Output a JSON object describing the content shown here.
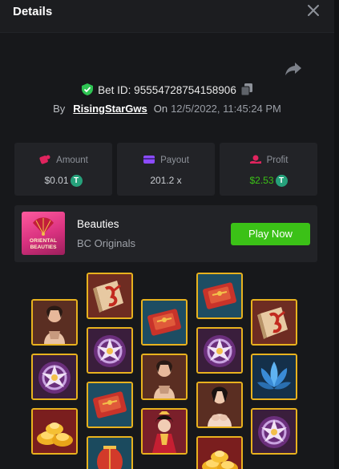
{
  "header": {
    "title": "Details",
    "close_icon": "close-icon"
  },
  "bet": {
    "bet_id_label": "Bet ID: 95554728754158906",
    "by_label": "By",
    "username": "RisingStarGws",
    "on_label": "On",
    "datetime": "12/5/2022, 11:45:24 PM"
  },
  "stats": {
    "amount": {
      "label": "Amount",
      "value": "$0.01",
      "icon": "dice-icon"
    },
    "payout": {
      "label": "Payout",
      "value": "201.2 x",
      "icon": "wallet-icon"
    },
    "profit": {
      "label": "Profit",
      "value": "$2.53",
      "icon": "money-hand-icon"
    }
  },
  "game": {
    "thumbnail_text_1": "ORIENTAL",
    "thumbnail_text_2": "BEAUTIES",
    "name": "Beauties",
    "provider": "BC Originals",
    "play_button": "Play Now"
  },
  "colors": {
    "background": "#17181b",
    "card": "#222327",
    "accent_green": "#3bc117",
    "symbol_border": "#e8b21e",
    "coin": "#26a17b"
  },
  "reels": [
    [
      "lady",
      "purple-flower",
      "gold-ingots"
    ],
    [
      "red-book",
      "purple-flower",
      "red-scroll",
      "lantern"
    ],
    [
      "red-scroll",
      "lady",
      "red-princess"
    ],
    [
      "red-scroll",
      "purple-flower",
      "lady-white",
      "gold-ingots"
    ],
    [
      "red-book",
      "blue-lotus",
      "purple-flower"
    ]
  ]
}
